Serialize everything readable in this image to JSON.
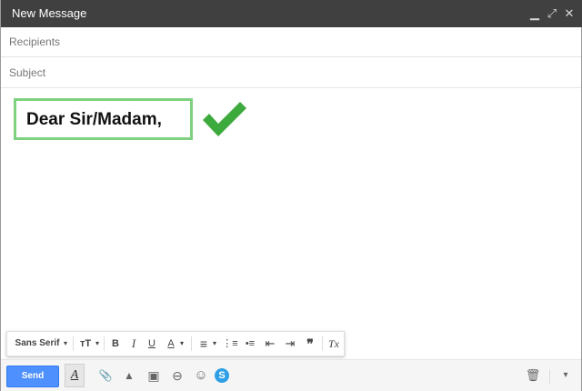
{
  "window": {
    "title": "New Message",
    "minimize_glyph": "▁",
    "expand_glyph": "⤢",
    "close_glyph": "✕"
  },
  "recipients": {
    "placeholder": "Recipients",
    "value": ""
  },
  "subject": {
    "placeholder": "Subject",
    "value": ""
  },
  "body": {
    "greeting": "Dear Sir/Madam,",
    "highlight_color": "#7ed17e",
    "checkmark_color": "#3daa3d"
  },
  "format_toolbar": {
    "font_family": "Sans Serif",
    "font_size_glyph": "ᴛT",
    "bold": "B",
    "italic": "I",
    "underline": "U",
    "text_color": "A",
    "align_glyph": "≡",
    "numbered_list_glyph": "⋮≡",
    "bulleted_list_glyph": "•≡",
    "indent_less_glyph": "⇤",
    "indent_more_glyph": "⇥",
    "quote_glyph": "❞",
    "remove_format": "Tx",
    "dropdown_glyph": "▾"
  },
  "bottom_toolbar": {
    "send_label": "Send",
    "formatting_toggle": "A",
    "attach_glyph": "📎",
    "drive_glyph": "▲",
    "photo_glyph": "▣",
    "link_glyph": "⊖",
    "emoji_glyph": "☺",
    "skype_glyph": "S",
    "trash_glyph": "🗑",
    "more_glyph": "▾",
    "accent_color": "#4d90fe",
    "skype_color": "#2fa0e6"
  }
}
